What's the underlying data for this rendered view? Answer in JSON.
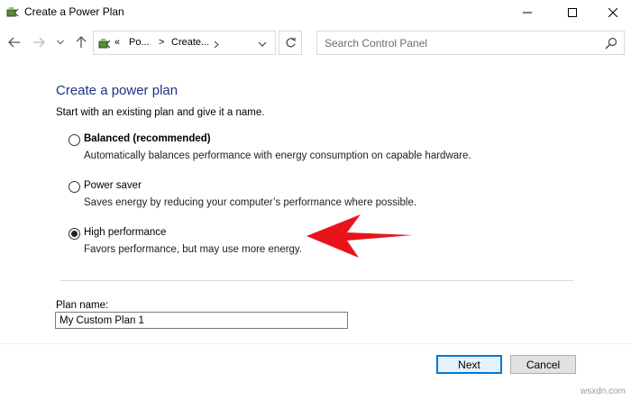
{
  "window": {
    "title": "Create a Power Plan"
  },
  "address_bar": {
    "crumbs": [
      "Po...",
      "Create..."
    ],
    "overflow": "«",
    "separator": ">"
  },
  "search": {
    "placeholder": "Search Control Panel"
  },
  "content": {
    "heading": "Create a power plan",
    "intro": "Start with an existing plan and give it a name.",
    "plans": [
      {
        "label": "Balanced (recommended)",
        "description": "Automatically balances performance with energy consumption on capable hardware.",
        "checked": false
      },
      {
        "label": "Power saver",
        "description": "Saves energy by reducing your computer’s performance where possible.",
        "checked": false
      },
      {
        "label": "High performance",
        "description": "Favors performance, but may use more energy.",
        "checked": true
      }
    ],
    "plan_name_label": "Plan name:",
    "plan_name_value": "My Custom Plan 1"
  },
  "buttons": {
    "next": "Next",
    "cancel": "Cancel"
  },
  "watermark": "wsxdn.com",
  "colors": {
    "heading": "#1e3287",
    "accent": "#0078d7",
    "annotation_arrow": "#e8141b"
  }
}
